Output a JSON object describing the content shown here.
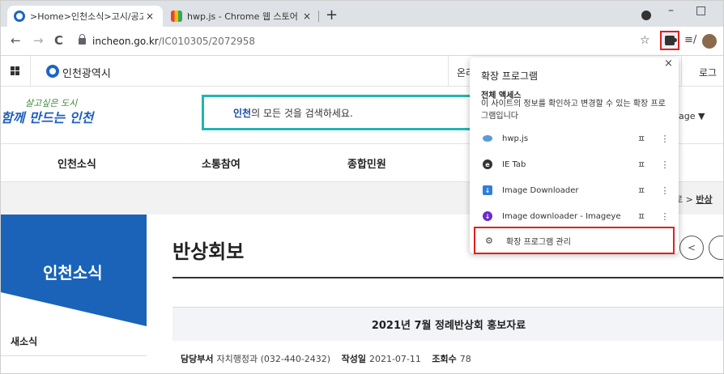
{
  "browser": {
    "tabs": [
      {
        "title": ">Home>인천소식>고시/공고/시",
        "active": true,
        "favicon_color": "#1a66c8"
      },
      {
        "title": "hwp.js - Chrome 웹 스토어",
        "active": false,
        "favicon_color": "#e94235"
      }
    ],
    "close_glyph": "×",
    "new_tab_glyph": "+",
    "back_glyph": "←",
    "forward_glyph": "→",
    "reload_glyph": "C",
    "url_domain": "incheon.go.kr",
    "url_path": "/IC010305/2072958",
    "star_glyph": "☆",
    "media_glyph": "≡/",
    "minimize_glyph": "–",
    "maximize_glyph": "□"
  },
  "site": {
    "name": "인천광역시",
    "top_link_mid": "온리",
    "top_link_right": "로그",
    "slogan_line1": "살고싶은 도시",
    "slogan_line2": "함께 만드는 인천",
    "search_keyword": "인천",
    "search_rest": "의 모든 것을 검색하세요.",
    "language_label": "uage ▼"
  },
  "gnb": [
    "인천소식",
    "소통참여",
    "종합민원"
  ],
  "breadcrumb": {
    "prev": "로 >",
    "current": "반상"
  },
  "sidebar": {
    "title": "인천소식",
    "sub_item": "새소식"
  },
  "article": {
    "title": "반상회보",
    "board_title": "2021년 7월 정례반상회 홍보자료",
    "meta": [
      {
        "label": "담당부서",
        "value": "자치행정과 (032-440-2432)"
      },
      {
        "label": "작성일",
        "value": "2021-07-11"
      },
      {
        "label": "조회수",
        "value": "78"
      }
    ],
    "share_glyph": "<"
  },
  "extensions_popup": {
    "title": "확장 프로그램",
    "close_glyph": "×",
    "section_label": "전체 액세스",
    "section_desc": "이 사이트의 정보를 확인하고 변경할 수 있는 확장 프로그램입니다",
    "pin_glyph": "ㅍ",
    "more_glyph": "⋮",
    "items": [
      {
        "name": "hwp.js",
        "icon": "hwp-icon",
        "icon_color": "#5b9bd5",
        "icon_glyph": ""
      },
      {
        "name": "IE Tab",
        "icon": "ie-tab-icon",
        "icon_color": "#333333",
        "icon_glyph": "e"
      },
      {
        "name": "Image Downloader",
        "icon": "image-downloader-icon",
        "icon_color": "#2f7fd8",
        "icon_glyph": "↓"
      },
      {
        "name": "Image downloader - Imageye",
        "icon": "imageye-icon",
        "icon_color": "#6a2cc8",
        "icon_glyph": "↓"
      }
    ],
    "manage_label": "확장 프로그램 관리",
    "manage_glyph": "⚙"
  },
  "colors": {
    "chrome_tabstrip": "#dee1e6",
    "highlight_red": "#e02020",
    "site_blue": "#1a63b8",
    "search_teal": "#22b5b0"
  }
}
